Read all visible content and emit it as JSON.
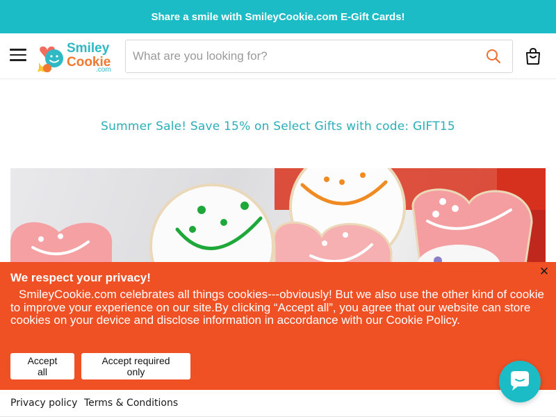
{
  "announcement": {
    "text": "Share a smile with SmileyCookie.com E-Gift Cards!"
  },
  "header": {
    "logo": {
      "line1": "Smiley",
      "line2": "Cookie",
      "line3": ".com",
      "brand_teal": "#2fb9c4",
      "brand_orange": "#f07830"
    },
    "search": {
      "placeholder": "What are you looking for?",
      "value": ""
    },
    "icons": {
      "menu": "hamburger-menu-icon",
      "search": "search-icon",
      "cart": "cart-bag-icon"
    }
  },
  "promo": {
    "text": "Summer Sale! Save 15% on Select Gifts with code: GIFT15"
  },
  "cookie_banner": {
    "title": "We respect your privacy!",
    "body": "SmileyCookie.com celebrates all things cookies---obviously! But we also use the other kind of cookie to improve your experience on our site.By clicking “Accept all”, you agree that our website can store cookies on your device and disclose information in accordance with our Cookie Policy.",
    "close": "✕",
    "accept_all": "Accept all",
    "accept_required": "Accept required only",
    "background": "#ef5125"
  },
  "footer": {
    "privacy": "Privacy policy",
    "terms": "Terms & Conditions"
  },
  "colors": {
    "accent": "#1bbcc5",
    "banner": "#ef5125"
  }
}
